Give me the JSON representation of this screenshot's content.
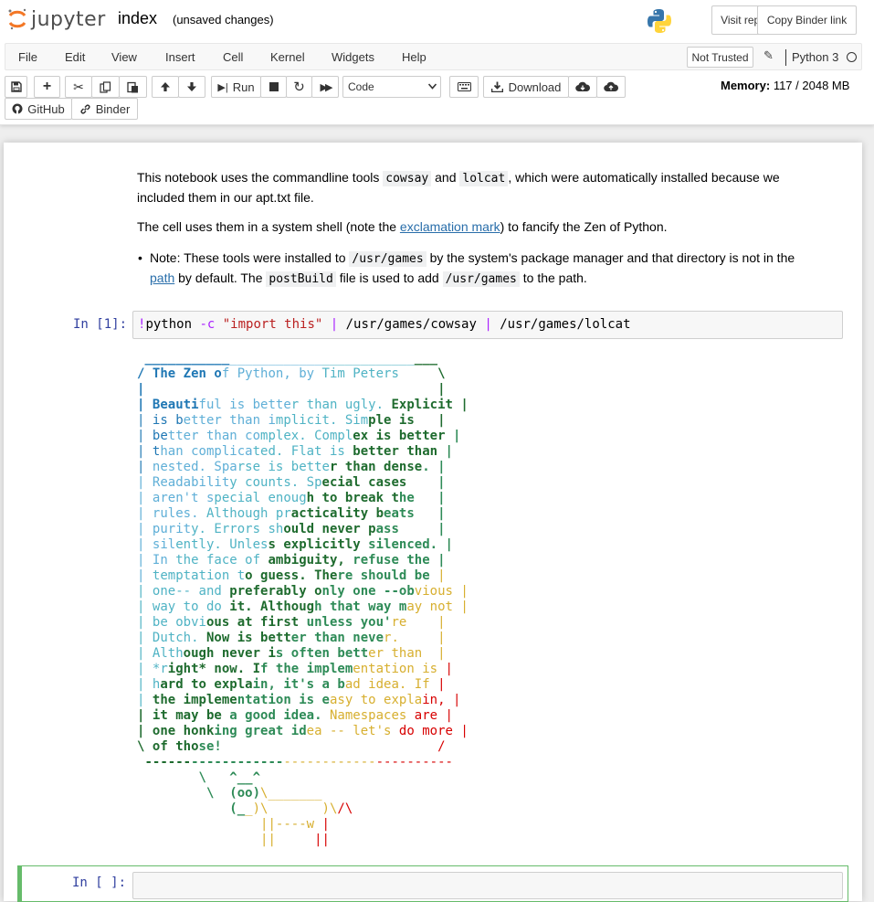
{
  "header": {
    "logo_text": "jupyter",
    "notebook_name": "index",
    "autosave_status": "(unsaved changes)",
    "visit_repo_label": "Visit repo",
    "copy_binder_label": "Copy Binder link"
  },
  "menubar": {
    "items": [
      "File",
      "Edit",
      "View",
      "Insert",
      "Cell",
      "Kernel",
      "Widgets",
      "Help"
    ],
    "trust_label": "Not Trusted",
    "kernel_name": "Python 3"
  },
  "toolbar": {
    "run_label": "Run",
    "cell_type": "Code",
    "download_label": "Download",
    "github_label": "GitHub",
    "binder_label": "Binder",
    "memory_label": "Memory:",
    "memory_value": "117 / 2048 MB"
  },
  "cells": {
    "md": {
      "p1_a": "This notebook uses the commandline tools ",
      "p1_code1": "cowsay",
      "p1_b": " and ",
      "p1_code2": "lolcat",
      "p1_c": ", which were automatically installed because we",
      "p1_line2": "included them in our apt.txt file.",
      "p2_a": "The cell uses them in a system shell (note the ",
      "p2_link": "exclamation mark",
      "p2_b": ") to fancify the Zen of Python.",
      "li_a": "Note: These tools were installed to ",
      "li_code1": "/usr/games",
      "li_b": " by the system's package manager and that directory is not in the",
      "li_link": "path",
      "li_c": " by default. The ",
      "li_code2": "postBuild",
      "li_d": " file is used to add ",
      "li_code3": "/usr/games",
      "li_e": " to the path."
    },
    "code1": {
      "prompt": "In [1]:",
      "bang": "!",
      "cmd": "python ",
      "flag": "-c",
      "space": " ",
      "arg": "\"import this\"",
      "pipe1": " | ",
      "path1a": "/usr/games/cowsay",
      "pipe2": " | ",
      "path2": "/usr/games/lolcat"
    },
    "code2": {
      "prompt": "In [ ]:"
    }
  },
  "output_colors": {
    "blue": "#1f77b4",
    "lightblue": "#5fafd7",
    "teal": "#4fb3c4",
    "darkgreen": "#1e6b2e",
    "green": "#2e8b57",
    "gold": "#d7af2f",
    "red": "#d70000"
  },
  "output_lines": [
    " ______________________________________",
    "/ The Zen of Python, by Tim Peters     \\",
    "|                                      |",
    "| Beautiful is better than ugly. Explicit |",
    "| is better than implicit. Simple is   |",
    "| better than complex. Complex is better |",
    "| than complicated. Flat is better than |",
    "| nested. Sparse is better than dense. |",
    "| Readability counts. Special cases    |",
    "| aren't special enough to break the   |",
    "| rules. Although practicality beats   |",
    "| purity. Errors should never pass     |",
    "| silently. Unless explicitly silenced. |",
    "| In the face of ambiguity, refuse the |",
    "| temptation to guess. There should be |",
    "| one-- and preferably only one --obvious |",
    "| way to do it. Although that way may not |",
    "| be obvious at first unless you're    |",
    "| Dutch. Now is better than never.     |",
    "| Although never is often better than  |",
    "| *right* now. If the implementation is |",
    "| hard to explain, it's a bad idea. If |",
    "| the implementation is easy to explain, |",
    "| it may be a good idea. Namespaces are |",
    "| one honking great idea -- let's do more |",
    "\\ of those!                            /",
    " ----------------------------------------",
    "        \\   ^__^",
    "         \\  (oo)\\_______",
    "            (__)\\       )\\/\\",
    "                ||----w |",
    "                ||     ||"
  ]
}
